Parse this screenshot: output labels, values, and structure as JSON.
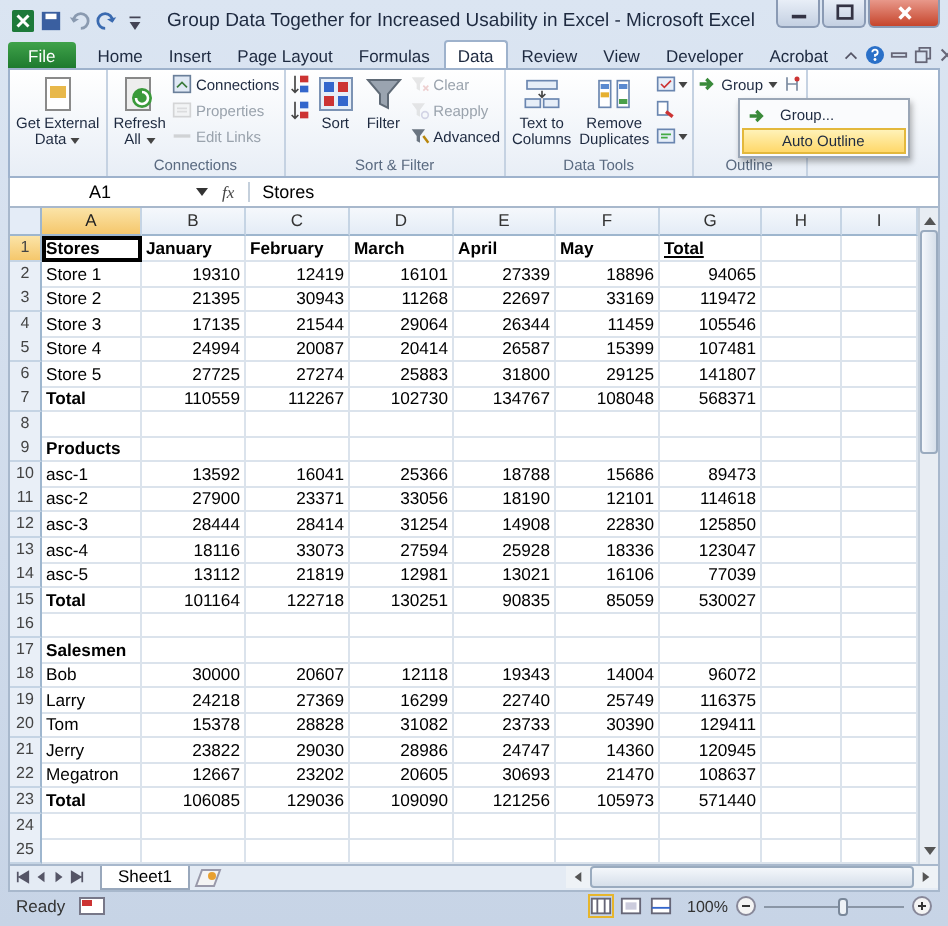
{
  "window": {
    "title": "Group Data Together for Increased Usability in Excel  -  Microsoft Excel"
  },
  "ribbon_tabs": [
    {
      "label": "File",
      "kind": "file",
      "selected": false
    },
    {
      "label": "Home",
      "kind": "tab",
      "selected": false
    },
    {
      "label": "Insert",
      "kind": "tab",
      "selected": false
    },
    {
      "label": "Page Layout",
      "kind": "tab",
      "selected": false
    },
    {
      "label": "Formulas",
      "kind": "tab",
      "selected": false
    },
    {
      "label": "Data",
      "kind": "tab",
      "selected": true
    },
    {
      "label": "Review",
      "kind": "tab",
      "selected": false
    },
    {
      "label": "View",
      "kind": "tab",
      "selected": false
    },
    {
      "label": "Developer",
      "kind": "tab",
      "selected": false
    },
    {
      "label": "Acrobat",
      "kind": "tab",
      "selected": false
    }
  ],
  "ribbon_groups": [
    {
      "columns": [
        [
          {
            "kind": "large",
            "lines": [
              "Get External",
              "Data"
            ],
            "dropdown": true,
            "disabled": false
          }
        ]
      ]
    },
    {
      "label": "Connections",
      "columns": [
        [
          {
            "kind": "large",
            "lines": [
              "Refresh",
              "All"
            ],
            "dropdown": true,
            "disabled": false
          }
        ],
        [
          {
            "kind": "small",
            "lines": [
              "Connections"
            ],
            "dropdown": false,
            "disabled": false
          },
          {
            "kind": "small",
            "lines": [
              "Properties"
            ],
            "dropdown": false,
            "disabled": true
          },
          {
            "kind": "small",
            "lines": [
              "Edit Links"
            ],
            "dropdown": false,
            "disabled": true
          }
        ]
      ]
    },
    {
      "label": "Sort & Filter",
      "columns": [
        [
          {
            "kind": "icon",
            "dropdown": false,
            "disabled": false
          },
          {
            "kind": "icon",
            "dropdown": false,
            "disabled": false
          }
        ],
        [
          {
            "kind": "large",
            "lines": [
              "Sort"
            ],
            "dropdown": false,
            "disabled": false
          }
        ],
        [
          {
            "kind": "large",
            "lines": [
              "Filter"
            ],
            "dropdown": false,
            "disabled": false
          }
        ],
        [
          {
            "kind": "small",
            "lines": [
              "Clear"
            ],
            "dropdown": false,
            "disabled": true
          },
          {
            "kind": "small",
            "lines": [
              "Reapply"
            ],
            "dropdown": false,
            "disabled": true
          },
          {
            "kind": "small",
            "lines": [
              "Advanced"
            ],
            "dropdown": false,
            "disabled": false
          }
        ]
      ]
    },
    {
      "label": "Data Tools",
      "columns": [
        [
          {
            "kind": "large",
            "lines": [
              "Text to",
              "Columns"
            ],
            "dropdown": false,
            "disabled": false
          }
        ],
        [
          {
            "kind": "large",
            "lines": [
              "Remove",
              "Duplicates"
            ],
            "dropdown": false,
            "disabled": false
          }
        ],
        [
          {
            "kind": "icon",
            "dropdown": true,
            "disabled": false
          },
          {
            "kind": "icon",
            "dropdown": false,
            "disabled": false
          },
          {
            "kind": "icon",
            "dropdown": true,
            "disabled": false
          }
        ]
      ]
    },
    {
      "label": "Outline",
      "columns": [
        [
          {
            "kind": "small",
            "lines": [
              "Group"
            ],
            "dropdown": true,
            "disabled": false
          }
        ],
        [
          {
            "kind": "icon",
            "dropdown": false,
            "disabled": false
          }
        ]
      ]
    }
  ],
  "outline_menu": [
    {
      "label": "Group...",
      "selected": false
    },
    {
      "label": "Auto Outline",
      "selected": true
    }
  ],
  "formula_bar": {
    "name_box": "A1",
    "function_button": "fx",
    "content": "Stores"
  },
  "sheet": {
    "columns": [
      {
        "label": "A",
        "selected": true
      },
      {
        "label": "B",
        "selected": false
      },
      {
        "label": "C",
        "selected": false
      },
      {
        "label": "D",
        "selected": false
      },
      {
        "label": "E",
        "selected": false
      },
      {
        "label": "F",
        "selected": false
      },
      {
        "label": "G",
        "selected": false
      },
      {
        "label": "H",
        "selected": false
      },
      {
        "label": "I",
        "selected": false
      }
    ],
    "rows": [
      {
        "number": "1",
        "kind": "header",
        "selected": true,
        "cells": [
          "Stores",
          "January",
          "February",
          "March",
          "April",
          "May",
          "Total"
        ],
        "underlined": [
          false,
          false,
          false,
          false,
          false,
          false,
          true
        ]
      },
      {
        "number": "2",
        "kind": "data",
        "selected": false,
        "cells": [
          "Store 1",
          "19310",
          "12419",
          "16101",
          "27339",
          "18896",
          "94065"
        ]
      },
      {
        "number": "3",
        "kind": "data",
        "selected": false,
        "cells": [
          "Store 2",
          "21395",
          "30943",
          "11268",
          "22697",
          "33169",
          "119472"
        ]
      },
      {
        "number": "4",
        "kind": "data",
        "selected": false,
        "cells": [
          "Store 3",
          "17135",
          "21544",
          "29064",
          "26344",
          "11459",
          "105546"
        ]
      },
      {
        "number": "5",
        "kind": "data",
        "selected": false,
        "cells": [
          "Store 4",
          "24994",
          "20087",
          "20414",
          "26587",
          "15399",
          "107481"
        ]
      },
      {
        "number": "6",
        "kind": "data",
        "selected": false,
        "cells": [
          "Store 5",
          "27725",
          "27274",
          "25883",
          "31800",
          "29125",
          "141807"
        ]
      },
      {
        "number": "7",
        "kind": "total",
        "selected": false,
        "cells": [
          "Total",
          "110559",
          "112267",
          "102730",
          "134767",
          "108048",
          "568371"
        ]
      },
      {
        "number": "8",
        "selected": false
      },
      {
        "number": "9",
        "kind": "total",
        "selected": false,
        "cells": [
          "Products"
        ]
      },
      {
        "number": "10",
        "kind": "data",
        "selected": false,
        "cells": [
          "asc-1",
          "13592",
          "16041",
          "25366",
          "18788",
          "15686",
          "89473"
        ]
      },
      {
        "number": "11",
        "kind": "data",
        "selected": false,
        "cells": [
          "asc-2",
          "27900",
          "23371",
          "33056",
          "18190",
          "12101",
          "114618"
        ]
      },
      {
        "number": "12",
        "kind": "data",
        "selected": false,
        "cells": [
          "asc-3",
          "28444",
          "28414",
          "31254",
          "14908",
          "22830",
          "125850"
        ]
      },
      {
        "number": "13",
        "kind": "data",
        "selected": false,
        "cells": [
          "asc-4",
          "18116",
          "33073",
          "27594",
          "25928",
          "18336",
          "123047"
        ]
      },
      {
        "number": "14",
        "kind": "data",
        "selected": false,
        "cells": [
          "asc-5",
          "13112",
          "21819",
          "12981",
          "13021",
          "16106",
          "77039"
        ]
      },
      {
        "number": "15",
        "kind": "total",
        "selected": false,
        "cells": [
          "Total",
          "101164",
          "122718",
          "130251",
          "90835",
          "85059",
          "530027"
        ]
      },
      {
        "number": "16",
        "selected": false
      },
      {
        "number": "17",
        "kind": "total",
        "selected": false,
        "cells": [
          "Salesmen"
        ]
      },
      {
        "number": "18",
        "kind": "data",
        "selected": false,
        "cells": [
          "Bob",
          "30000",
          "20607",
          "12118",
          "19343",
          "14004",
          "96072"
        ]
      },
      {
        "number": "19",
        "kind": "data",
        "selected": false,
        "cells": [
          "Larry",
          "24218",
          "27369",
          "16299",
          "22740",
          "25749",
          "116375"
        ]
      },
      {
        "number": "20",
        "kind": "data",
        "selected": false,
        "cells": [
          "Tom",
          "15378",
          "28828",
          "31082",
          "23733",
          "30390",
          "129411"
        ]
      },
      {
        "number": "21",
        "kind": "data",
        "selected": false,
        "cells": [
          "Jerry",
          "23822",
          "29030",
          "28986",
          "24747",
          "14360",
          "120945"
        ]
      },
      {
        "number": "22",
        "kind": "data",
        "selected": false,
        "cells": [
          "Megatron",
          "12667",
          "23202",
          "20605",
          "30693",
          "21470",
          "108637"
        ]
      },
      {
        "number": "23",
        "kind": "total",
        "selected": false,
        "cells": [
          "Total",
          "106085",
          "129036",
          "109090",
          "121256",
          "105973",
          "571440"
        ]
      },
      {
        "number": "24",
        "selected": false
      },
      {
        "number": "25",
        "selected": false
      }
    ]
  },
  "sheet_tabs": [
    {
      "label": "Sheet1",
      "selected": true
    }
  ],
  "status_bar": {
    "status": "Ready",
    "zoom": "100%",
    "zoom_slider": {
      "level": 0.55
    }
  }
}
